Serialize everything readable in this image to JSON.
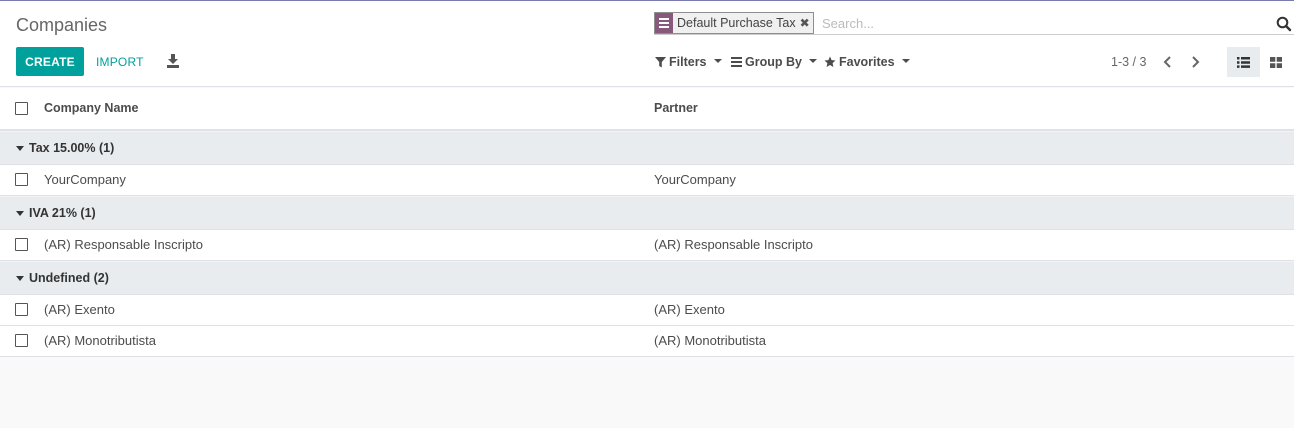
{
  "title": "Companies",
  "toolbar": {
    "create_label": "CREATE",
    "import_label": "IMPORT"
  },
  "search": {
    "facet_label": "Default Purchase Tax",
    "placeholder": "Search..."
  },
  "filters": {
    "filters_label": "Filters",
    "groupby_label": "Group By",
    "favorites_label": "Favorites"
  },
  "pager": {
    "text": "1-3 / 3"
  },
  "columns": {
    "company": "Company Name",
    "partner": "Partner"
  },
  "groups": [
    {
      "label": "Tax 15.00% (1)",
      "rows": [
        {
          "company": "YourCompany",
          "partner": "YourCompany"
        }
      ]
    },
    {
      "label": "IVA 21% (1)",
      "rows": [
        {
          "company": "(AR) Responsable Inscripto",
          "partner": "(AR) Responsable Inscripto"
        }
      ]
    },
    {
      "label": "Undefined (2)",
      "rows": [
        {
          "company": "(AR) Exento",
          "partner": "(AR) Exento"
        },
        {
          "company": "(AR) Monotributista",
          "partner": "(AR) Monotributista"
        }
      ]
    }
  ],
  "colors": {
    "primary": "#00a09d",
    "facet": "#875a7b",
    "group_bg": "#e9ecef"
  }
}
